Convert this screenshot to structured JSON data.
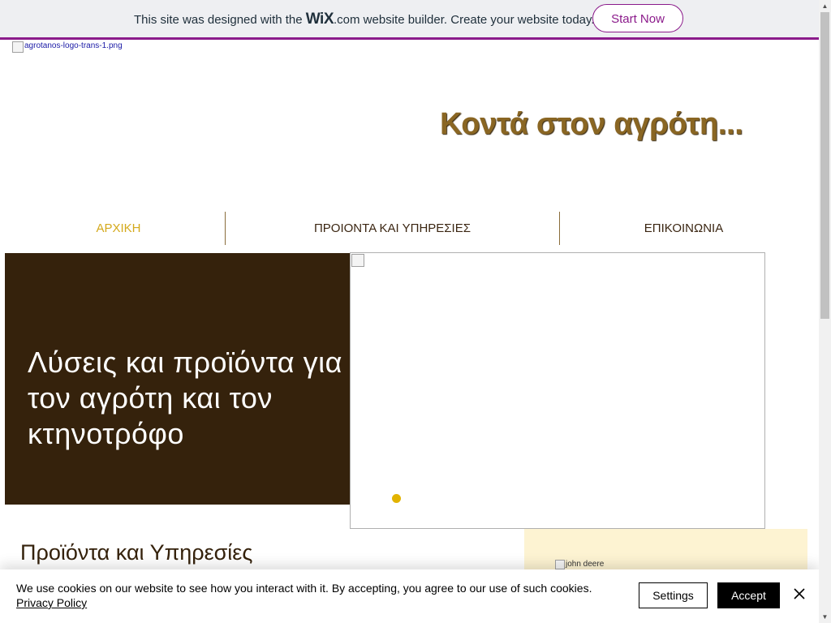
{
  "wix_banner": {
    "prefix": "This site was designed with the ",
    "logo": "WiX",
    "dotcom": ".com",
    "suffix": " website builder. Create your website today.",
    "cta_label": "Start Now",
    "accent_color": "#8b1b8b"
  },
  "header": {
    "logo_alt": "agrotanos-logo-trans-1.png",
    "tagline": "Κοντά στον αγρότη..."
  },
  "nav": {
    "items": [
      {
        "label": "ΑΡΧΙΚΗ",
        "active": true
      },
      {
        "label": "ΠΡΟΙΟΝΤΑ ΚΑΙ ΥΠΗΡΕΣΙΕΣ",
        "active": false
      },
      {
        "label": "ΕΠΙΚΟΙΝΩΝΙΑ",
        "active": false
      }
    ],
    "active_color": "#d4a91c"
  },
  "hero": {
    "title": "Λύσεις και προϊόντα για τον αγρότη και τον κτηνοτρόφο",
    "background_color": "#35220c",
    "slide_indicator_color": "#e2b300"
  },
  "products": {
    "heading": "Προϊόντα και Υπηρεσίες",
    "side_image_alt": "john deere"
  },
  "cookie_banner": {
    "text": "We use cookies on our website to see how you interact with it. By accepting, you agree to our use of such cookies.",
    "policy_link": "Privacy Policy",
    "settings_label": "Settings",
    "accept_label": "Accept",
    "close_icon": "close-icon"
  }
}
